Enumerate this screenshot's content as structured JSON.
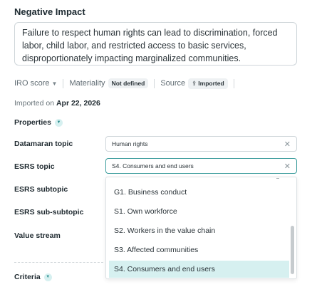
{
  "section_title": "Negative Impact",
  "description": "Failure to respect human rights can lead to discrimination, forced labor, child labor, and restricted access to basic services, disproportionately impacting marginalized communities.",
  "meta": {
    "iro_score_label": "IRO score",
    "materiality_label": "Materiality",
    "materiality_value": "Not defined",
    "source_label": "Source",
    "source_value": "Imported",
    "source_icon": "upload-icon"
  },
  "imported_on": {
    "prefix": "Imported on",
    "date": "Apr 22, 2026"
  },
  "properties": {
    "header": "Properties",
    "fields": [
      {
        "label": "Datamaran topic",
        "value": "Human rights"
      },
      {
        "label": "ESRS topic",
        "value": "S4. Consumers and end users"
      },
      {
        "label": "ESRS subtopic",
        "value": ""
      },
      {
        "label": "ESRS sub-subtopic",
        "value": ""
      },
      {
        "label": "Value stream",
        "value": ""
      }
    ]
  },
  "dropdown": {
    "options": [
      "G1. Business conduct",
      "S1. Own workforce",
      "S2. Workers in the value chain",
      "S3. Affected communities",
      "S4. Consumers and end users"
    ],
    "selected": "S4. Consumers and end users"
  },
  "criteria": {
    "header": "Criteria"
  },
  "colors": {
    "accent": "#3c9d9d",
    "selected_bg": "#d6f0f0",
    "border": "#cfd6da"
  }
}
